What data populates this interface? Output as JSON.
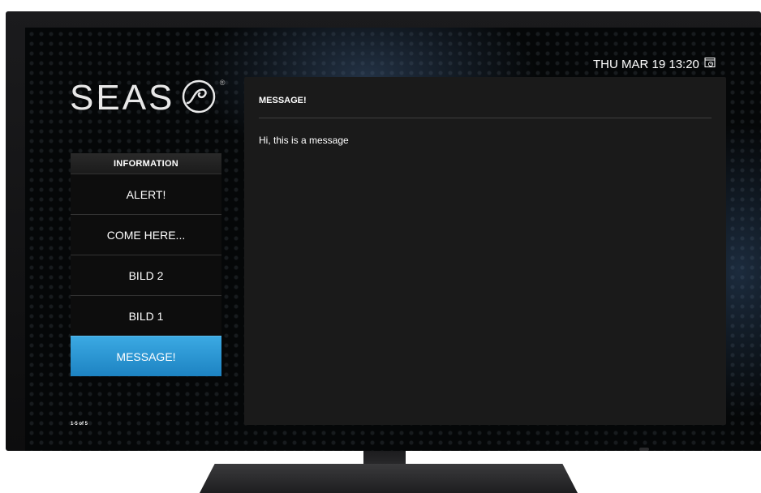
{
  "header": {
    "logo_text": "SEAS",
    "logo_registered": "®",
    "datetime": "THU MAR 19 13:20",
    "clock_icon": "schedule-icon"
  },
  "sidebar": {
    "header": "INFORMATION",
    "items": [
      {
        "label": "ALERT!",
        "active": false
      },
      {
        "label": "COME HERE...",
        "active": false
      },
      {
        "label": "BILD 2",
        "active": false
      },
      {
        "label": "BILD 1",
        "active": false
      },
      {
        "label": "MESSAGE!",
        "active": true
      }
    ],
    "page_count": "1-5 of 5"
  },
  "panel": {
    "title": "MESSAGE!",
    "body": "Hi, this is a message"
  },
  "colors": {
    "accent": "#2a96d4",
    "panel_bg": "#1a1a1a"
  }
}
